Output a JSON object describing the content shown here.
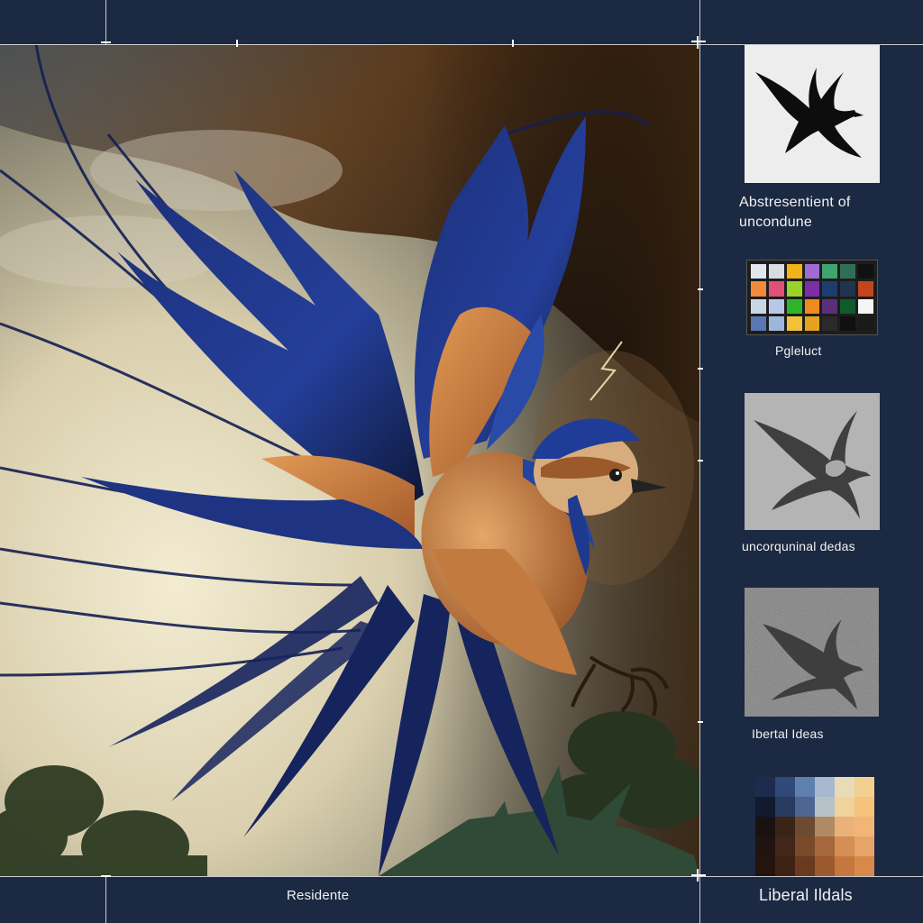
{
  "captions": {
    "thumb1": "Abstresentient of uncondune",
    "palette": "Pgleluct",
    "thumb2": "uncorquninal dedas",
    "thumb3": "Ibertal Ideas",
    "mosaic": "Liberal Ildals",
    "bottom": "Residente"
  },
  "palette_colors": [
    "#dfe6ee",
    "#d8dde4",
    "#f2b21a",
    "#9f6cd6",
    "#3ea66e",
    "#2f6f5a",
    "#111111",
    "#f08a3c",
    "#e0507a",
    "#9ad22a",
    "#7a2fa6",
    "#1c3d6e",
    "#20344f",
    "#c2461d",
    "#c9d6e6",
    "#b9c8e6",
    "#2fb52a",
    "#ef8b1e",
    "#5a2f7a",
    "#0f5b2a",
    "#f5f5f5",
    "#5877b4",
    "#9fb6dc",
    "#f0c23a",
    "#e6a21e",
    "#2a2a2a",
    "#101010",
    "#1a1a1a"
  ],
  "mosaic_colors": [
    "#1d2b4e",
    "#30487a",
    "#5f7fae",
    "#a7b8cf",
    "#e7dcb6",
    "#f3cf90",
    "#121a30",
    "#283a60",
    "#4d6590",
    "#b6c2c8",
    "#f0d39a",
    "#f6c27c",
    "#1a1210",
    "#3a2418",
    "#6d4a32",
    "#b08a64",
    "#eab17a",
    "#f1b676",
    "#201410",
    "#43261a",
    "#7a4a2a",
    "#a5683c",
    "#d48e56",
    "#e6a36a",
    "#24140e",
    "#3e2314",
    "#6a3a1e",
    "#9a5a2e",
    "#c5783e",
    "#d8894a"
  ]
}
